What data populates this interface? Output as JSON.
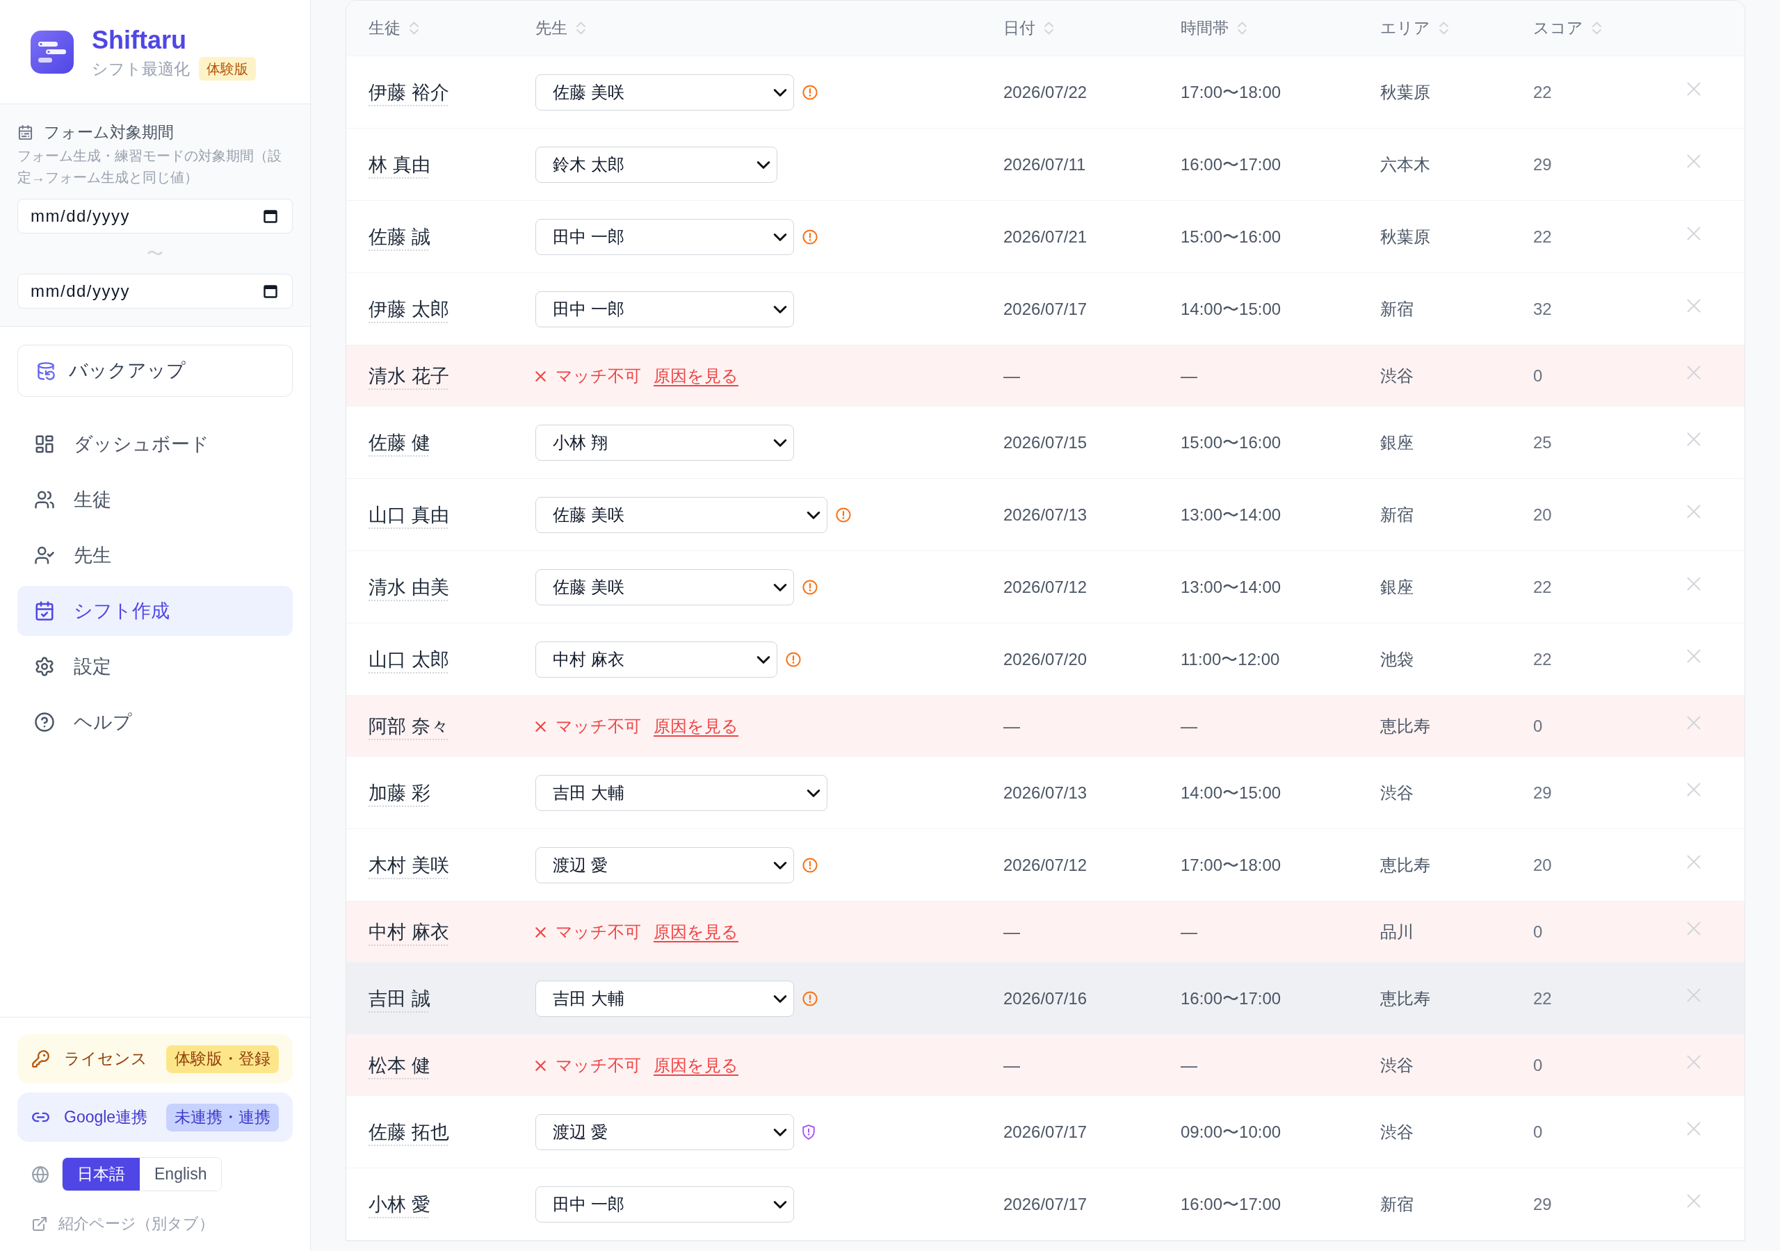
{
  "sidebar": {
    "brand": {
      "name": "Shiftaru",
      "tagline": "シフト最適化",
      "badge": "体験版"
    },
    "form_period": {
      "title": "フォーム対象期間",
      "description": "フォーム生成・練習モードの対象期間（設定→フォーム生成と同じ値）",
      "start": {
        "placeholder": "mm/dd/yyyy"
      },
      "separator": "〜",
      "end": {
        "placeholder": "mm/dd/yyyy"
      }
    },
    "backup_button": "バックアップ",
    "nav": [
      {
        "label": "ダッシュボード",
        "selected": false
      },
      {
        "label": "生徒",
        "selected": false
      },
      {
        "label": "先生",
        "selected": false
      },
      {
        "label": "シフト作成",
        "selected": true
      },
      {
        "label": "設定",
        "selected": false
      },
      {
        "label": "ヘルプ",
        "selected": false
      }
    ],
    "license": {
      "label": "ライセンス",
      "badge": "体験版・登録"
    },
    "google": {
      "label": "Google連携",
      "badge": "未連携・連携"
    },
    "languages": [
      {
        "label": "日本語",
        "selected": true
      },
      {
        "label": "English",
        "selected": false
      }
    ],
    "intro_link": "紹介ページ（別タブ）"
  },
  "table": {
    "columns": [
      {
        "label": "生徒",
        "sortable": true
      },
      {
        "label": "先生",
        "sortable": true
      },
      {
        "label": "日付",
        "sortable": true
      },
      {
        "label": "時間帯",
        "sortable": true
      },
      {
        "label": "エリア",
        "sortable": true
      },
      {
        "label": "スコア",
        "sortable": true
      }
    ],
    "rows": [
      {
        "kind": "assigned",
        "student": "伊藤 裕介",
        "teacher": "佐藤 美咲",
        "flag": {
          "kind": "alert"
        },
        "date": "2026/07/22",
        "time": "17:00〜18:00",
        "area": "秋葉原",
        "score": "22",
        "hovered": false
      },
      {
        "kind": "assigned",
        "student": "林 真由",
        "teacher": "鈴木 太郎",
        "date": "2026/07/11",
        "time": "16:00〜17:00",
        "area": "六本木",
        "score": "29",
        "hovered": false
      },
      {
        "kind": "assigned",
        "student": "佐藤 誠",
        "teacher": "田中 一郎",
        "flag": {
          "kind": "alert"
        },
        "date": "2026/07/21",
        "time": "15:00〜16:00",
        "area": "秋葉原",
        "score": "22",
        "hovered": false
      },
      {
        "kind": "assigned",
        "student": "伊藤 太郎",
        "teacher": "田中 一郎",
        "date": "2026/07/17",
        "time": "14:00〜15:00",
        "area": "新宿",
        "score": "32",
        "hovered": false
      },
      {
        "kind": "unmatched",
        "student": "清水 花子",
        "status": "マッチ不可",
        "link": "原因を見る",
        "date": "—",
        "time": "—",
        "area": "渋谷",
        "score": "0",
        "hovered": false
      },
      {
        "kind": "assigned",
        "student": "佐藤 健",
        "teacher": "小林 翔",
        "date": "2026/07/15",
        "time": "15:00〜16:00",
        "area": "銀座",
        "score": "25",
        "hovered": false
      },
      {
        "kind": "assigned",
        "student": "山口 真由",
        "teacher": "佐藤 美咲",
        "flag": {
          "kind": "alert"
        },
        "date": "2026/07/13",
        "time": "13:00〜14:00",
        "area": "新宿",
        "score": "20",
        "hovered": false
      },
      {
        "kind": "assigned",
        "student": "清水 由美",
        "teacher": "佐藤 美咲",
        "flag": {
          "kind": "alert"
        },
        "date": "2026/07/12",
        "time": "13:00〜14:00",
        "area": "銀座",
        "score": "22",
        "hovered": false
      },
      {
        "kind": "assigned",
        "student": "山口 太郎",
        "teacher": "中村 麻衣",
        "flag": {
          "kind": "alert"
        },
        "date": "2026/07/20",
        "time": "11:00〜12:00",
        "area": "池袋",
        "score": "22",
        "hovered": false
      },
      {
        "kind": "unmatched",
        "student": "阿部 奈々",
        "status": "マッチ不可",
        "link": "原因を見る",
        "date": "—",
        "time": "—",
        "area": "恵比寿",
        "score": "0",
        "hovered": false
      },
      {
        "kind": "assigned",
        "student": "加藤 彩",
        "teacher": "吉田 大輔",
        "date": "2026/07/13",
        "time": "14:00〜15:00",
        "area": "渋谷",
        "score": "29",
        "hovered": false
      },
      {
        "kind": "assigned",
        "student": "木村 美咲",
        "teacher": "渡辺 愛",
        "flag": {
          "kind": "alert"
        },
        "date": "2026/07/12",
        "time": "17:00〜18:00",
        "area": "恵比寿",
        "score": "20",
        "hovered": false
      },
      {
        "kind": "unmatched",
        "student": "中村 麻衣",
        "status": "マッチ不可",
        "link": "原因を見る",
        "date": "—",
        "time": "—",
        "area": "品川",
        "score": "0",
        "hovered": false
      },
      {
        "kind": "assigned",
        "student": "吉田 誠",
        "teacher": "吉田 大輔",
        "flag": {
          "kind": "alert"
        },
        "date": "2026/07/16",
        "time": "16:00〜17:00",
        "area": "恵比寿",
        "score": "22",
        "hovered": true
      },
      {
        "kind": "unmatched",
        "student": "松本 健",
        "status": "マッチ不可",
        "link": "原因を見る",
        "date": "—",
        "time": "—",
        "area": "渋谷",
        "score": "0",
        "hovered": false
      },
      {
        "kind": "assigned",
        "student": "佐藤 拓也",
        "teacher": "渡辺 愛",
        "flag": {
          "kind": "shield"
        },
        "date": "2026/07/17",
        "time": "09:00〜10:00",
        "area": "渋谷",
        "score": "0",
        "hovered": false
      },
      {
        "kind": "assigned",
        "student": "小林 愛",
        "teacher": "田中 一郎",
        "date": "2026/07/17",
        "time": "16:00〜17:00",
        "area": "新宿",
        "score": "29",
        "hovered": false
      }
    ]
  }
}
